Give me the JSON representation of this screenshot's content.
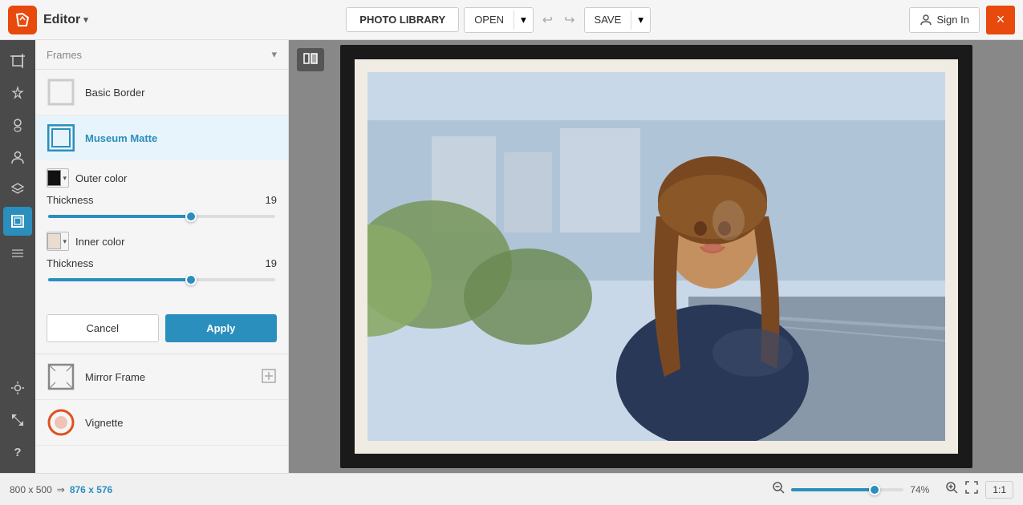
{
  "app": {
    "title": "Editor",
    "logo_symbol": "✦"
  },
  "topbar": {
    "photo_library": "PHOTO LIBRARY",
    "open": "OPEN",
    "save": "SAVE",
    "sign_in": "Sign In",
    "close": "×"
  },
  "left_panel": {
    "section_label": "Frames",
    "items": [
      {
        "id": "basic-border",
        "label": "Basic Border",
        "active": false
      },
      {
        "id": "museum-matte",
        "label": "Museum Matte",
        "active": true
      },
      {
        "id": "mirror-frame",
        "label": "Mirror Frame",
        "active": false
      },
      {
        "id": "vignette",
        "label": "Vignette",
        "active": false
      }
    ],
    "museum_matte": {
      "outer_color_label": "Outer color",
      "outer_color": "#111111",
      "outer_thickness_label": "Thickness",
      "outer_thickness_value": "19",
      "outer_slider_pct": 63,
      "inner_color_label": "Inner color",
      "inner_color": "#e8ddd0",
      "inner_thickness_label": "Thickness",
      "inner_thickness_value": "19",
      "inner_slider_pct": 63
    },
    "cancel_label": "Cancel",
    "apply_label": "Apply"
  },
  "bottom_bar": {
    "orig_width": "800",
    "orig_height": "500",
    "arrow": "⇒",
    "new_width": "876",
    "new_height": "576",
    "zoom_pct": "74%",
    "ratio": "1:1"
  },
  "sidebar_icons": [
    {
      "id": "crop",
      "symbol": "⊞",
      "active": false
    },
    {
      "id": "enhance",
      "symbol": "✦",
      "active": false
    },
    {
      "id": "retouch",
      "symbol": "✏",
      "active": false
    },
    {
      "id": "portrait",
      "symbol": "◉",
      "active": false
    },
    {
      "id": "layers",
      "symbol": "⊕",
      "active": false
    },
    {
      "id": "frames",
      "symbol": "▣",
      "active": true
    },
    {
      "id": "texture",
      "symbol": "≋",
      "active": false
    },
    {
      "id": "light",
      "symbol": "✺",
      "active": false
    },
    {
      "id": "resize",
      "symbol": "⤡",
      "active": false
    },
    {
      "id": "help",
      "symbol": "?",
      "active": false
    }
  ]
}
